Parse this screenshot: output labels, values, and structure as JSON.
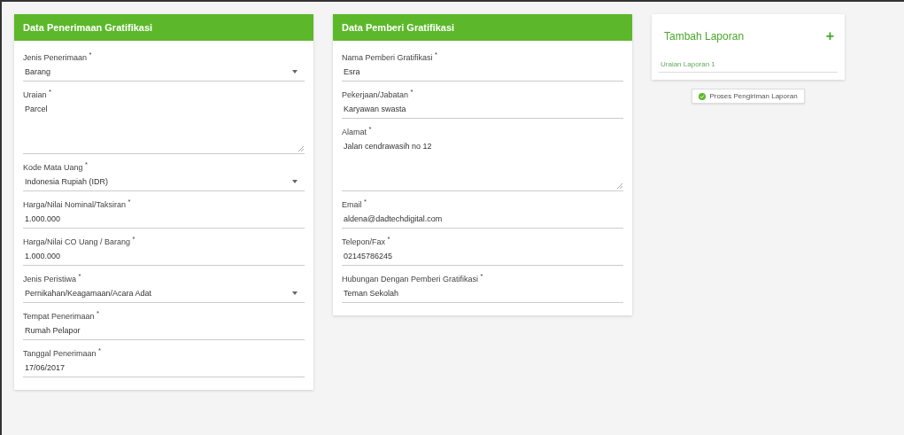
{
  "cards": [
    {
      "title": "Data Penerimaan Gratifikasi",
      "fields": [
        {
          "kind": "select",
          "label": "Jenis Penerimaan $^{*}$",
          "value": "Barang"
        },
        {
          "kind": "textarea",
          "label": "Uraian $^{*}$",
          "value": "Parcel"
        },
        {
          "kind": "select",
          "label": "Kode Mata Uang $^{*}$",
          "value": "Indonesia Rupiah (IDR)"
        },
        {
          "kind": "text",
          "label": "Harga/Nilai Nominal/Taksiran $^{*}$",
          "value": "1.000.000"
        },
        {
          "kind": "text",
          "label": "Harga/Nilai CO Uang / Barang $^{*}$",
          "value": "1.000.000"
        },
        {
          "kind": "select",
          "label": "Jenis Peristiwa $^{*}$",
          "value": "Pernikahan/Keagamaan/Acara Adat"
        },
        {
          "kind": "text",
          "label": "Tempat Penerimaan $^{*}$",
          "value": "Rumah Pelapor"
        },
        {
          "kind": "text",
          "label": "Tanggal Penerimaan $^{*}$",
          "value": "17/06/2017"
        }
      ]
    },
    {
      "title": "Data Pemberi Gratifikasi",
      "fields": [
        {
          "kind": "text",
          "label": "Nama Pemberi Gratifikasi $^{*}$",
          "value": "Esra"
        },
        {
          "kind": "text",
          "label": "Pekerjaan/Jabatan $^{*}$",
          "value": "Karyawan swasta"
        },
        {
          "kind": "textarea",
          "label": "Alamat $^{*}$",
          "value": "Jalan cendrawasih no 12"
        },
        {
          "kind": "text",
          "label": "Email $^{*}$",
          "value": "aldena@dadtechdigital.com"
        },
        {
          "kind": "text",
          "label": "Telepon/Fax $^{*}$",
          "value": "02145786245"
        },
        {
          "kind": "text",
          "label": "Hubungan Dengan Pemberi Gratifikasi $^{*}$",
          "value": "Teman Sekolah"
        }
      ]
    }
  ],
  "side": {
    "title": "Tambah Laporan",
    "add": "+",
    "items": [
      {
        "label": "Uraian Laporan 1"
      }
    ],
    "submit": "Proses Pengiriman Laporan"
  }
}
